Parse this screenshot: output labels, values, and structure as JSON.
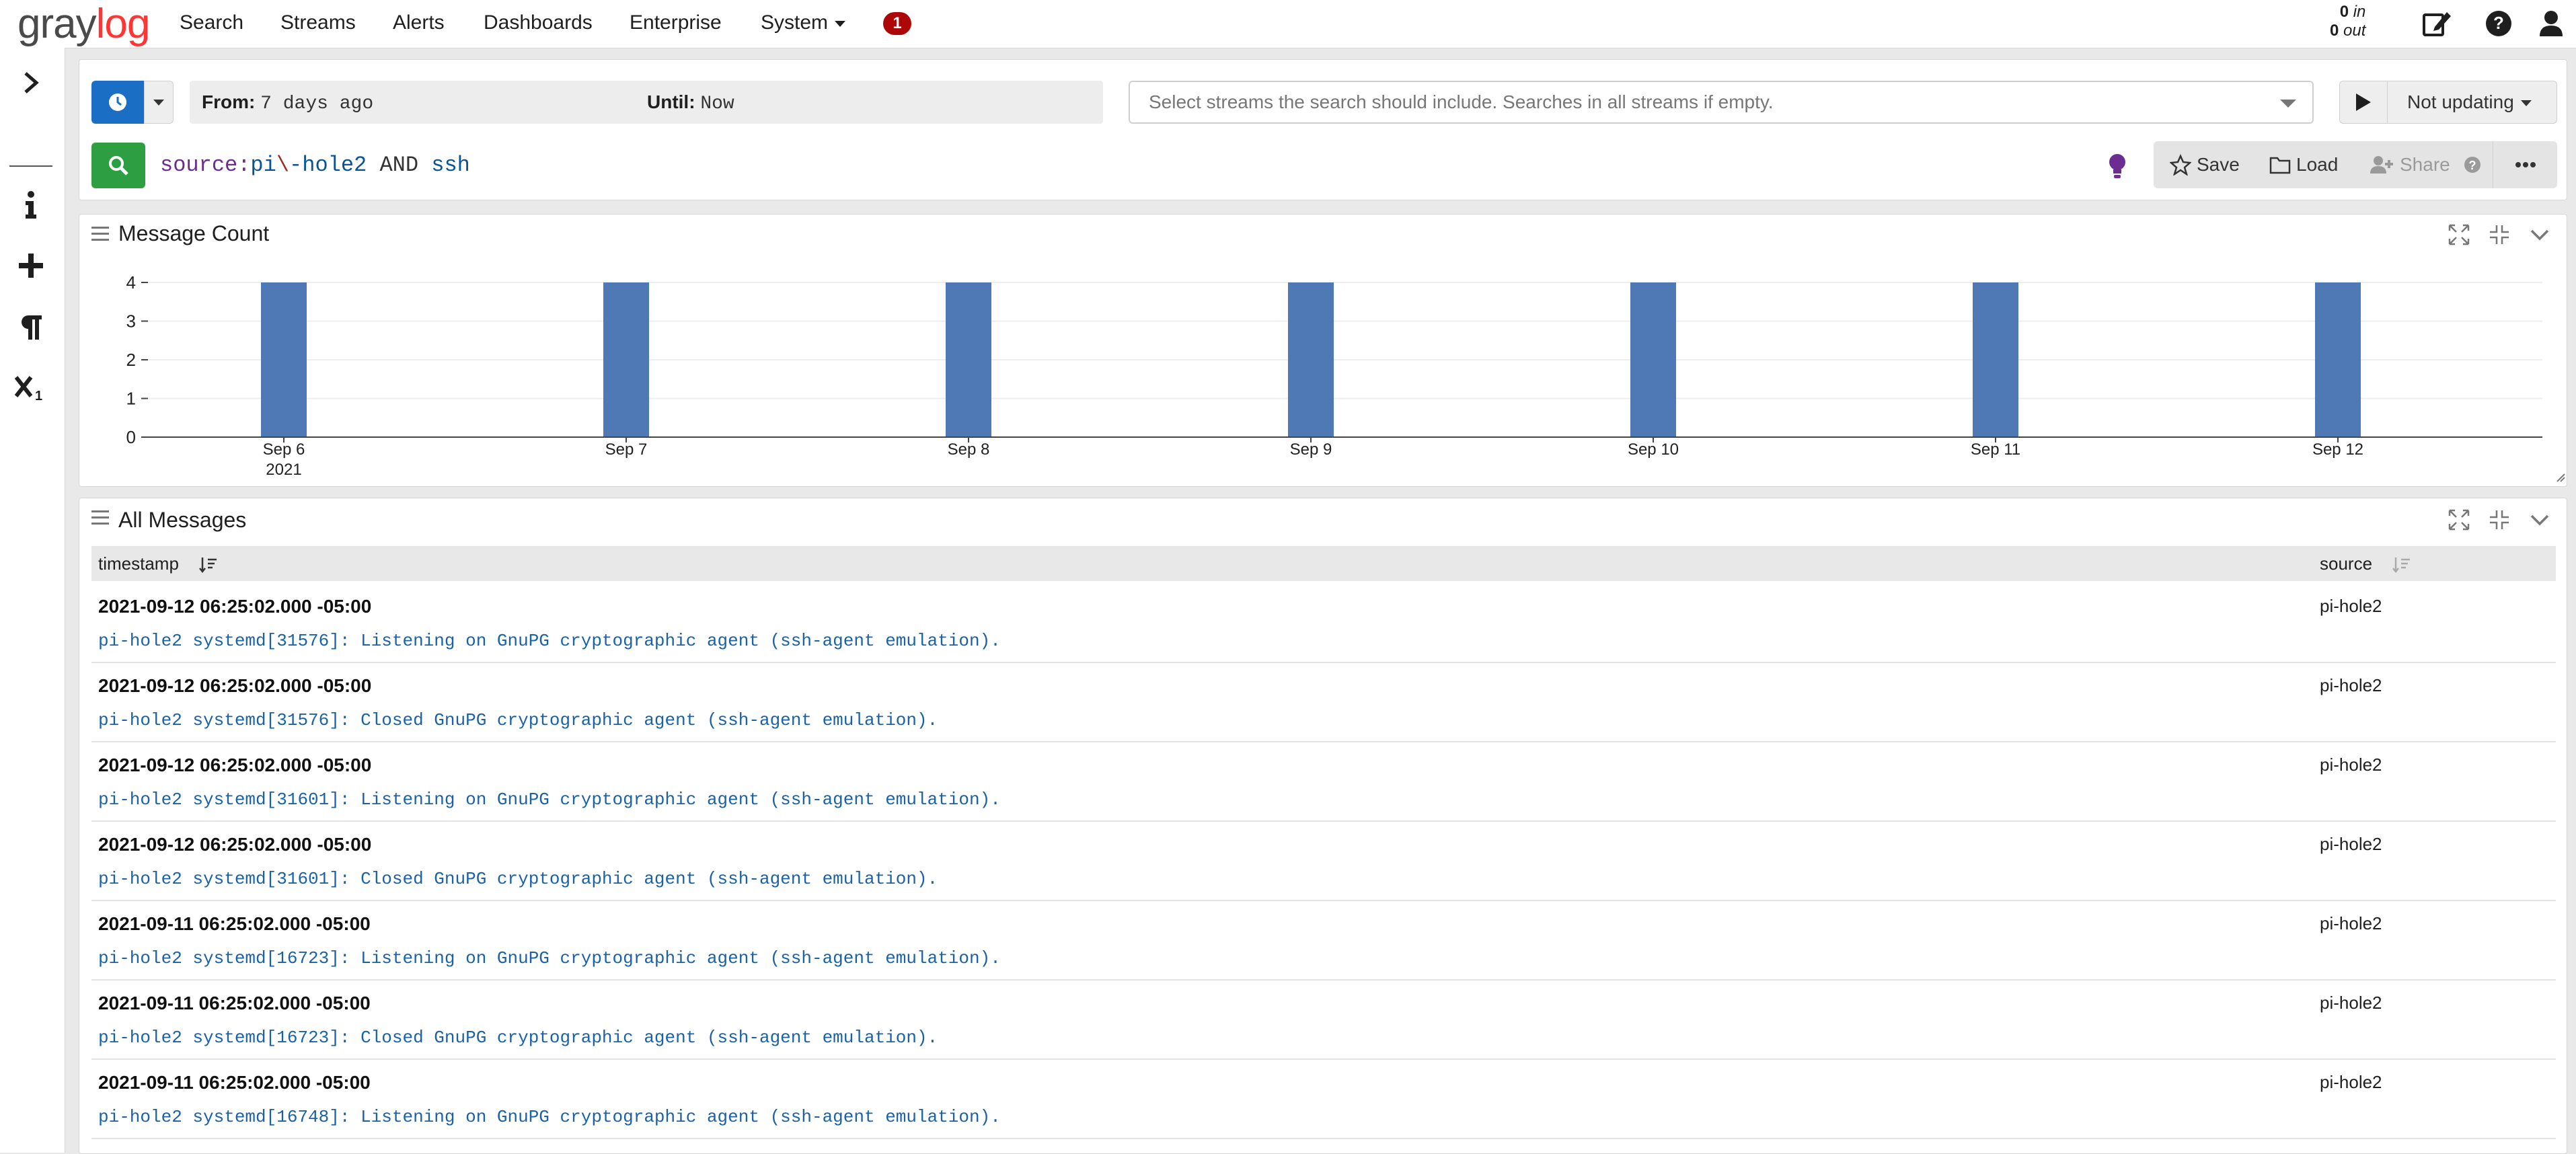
{
  "nav": {
    "logo_gray": "gray",
    "logo_red": "log",
    "links": [
      "Search",
      "Streams",
      "Alerts",
      "Dashboards",
      "Enterprise"
    ],
    "system_label": "System",
    "notification_count": "1",
    "throughput": {
      "in_count": "0",
      "in_label": "in",
      "out_count": "0",
      "out_label": "out"
    },
    "icons": [
      "edit-icon",
      "help-icon",
      "user-icon"
    ]
  },
  "sidebar": {
    "icons": [
      "expand-chevron-icon",
      "info-icon",
      "plus-icon",
      "paragraph-icon",
      "function-icon"
    ]
  },
  "search": {
    "from_label": "From:",
    "from_value": "7 days ago",
    "until_label": "Until:",
    "until_value": "Now",
    "streams_placeholder": "Select streams the search should include. Searches in all streams if empty.",
    "refresh_label": "Not updating",
    "query": {
      "field": "source:",
      "val1": "pi",
      "esc": "\\",
      "val2": "-hole2",
      "op": "AND",
      "term": "ssh"
    },
    "actions": {
      "save": "Save",
      "load": "Load",
      "share": "Share"
    }
  },
  "message_count_widget": {
    "title": "Message Count"
  },
  "chart_data": {
    "type": "bar",
    "categories": [
      "Sep 6",
      "Sep 7",
      "Sep 8",
      "Sep 9",
      "Sep 10",
      "Sep 11",
      "Sep 12"
    ],
    "year_label": "2021",
    "values": [
      4,
      4,
      4,
      4,
      4,
      4,
      4
    ],
    "ylim": [
      0,
      4
    ],
    "yticks": [
      0,
      1,
      2,
      3,
      4
    ],
    "grid": true,
    "color": "#4e79b4"
  },
  "messages_widget": {
    "title": "All Messages",
    "columns": {
      "timestamp": "timestamp",
      "source": "source"
    },
    "rows": [
      {
        "timestamp": "2021-09-12 06:25:02.000 -05:00",
        "source": "pi-hole2",
        "message": "pi-hole2 systemd[31576]: Listening on GnuPG cryptographic agent (ssh-agent emulation)."
      },
      {
        "timestamp": "2021-09-12 06:25:02.000 -05:00",
        "source": "pi-hole2",
        "message": "pi-hole2 systemd[31576]: Closed GnuPG cryptographic agent (ssh-agent emulation)."
      },
      {
        "timestamp": "2021-09-12 06:25:02.000 -05:00",
        "source": "pi-hole2",
        "message": "pi-hole2 systemd[31601]: Listening on GnuPG cryptographic agent (ssh-agent emulation)."
      },
      {
        "timestamp": "2021-09-12 06:25:02.000 -05:00",
        "source": "pi-hole2",
        "message": "pi-hole2 systemd[31601]: Closed GnuPG cryptographic agent (ssh-agent emulation)."
      },
      {
        "timestamp": "2021-09-11 06:25:02.000 -05:00",
        "source": "pi-hole2",
        "message": "pi-hole2 systemd[16723]: Listening on GnuPG cryptographic agent (ssh-agent emulation)."
      },
      {
        "timestamp": "2021-09-11 06:25:02.000 -05:00",
        "source": "pi-hole2",
        "message": "pi-hole2 systemd[16723]: Closed GnuPG cryptographic agent (ssh-agent emulation)."
      },
      {
        "timestamp": "2021-09-11 06:25:02.000 -05:00",
        "source": "pi-hole2",
        "message": "pi-hole2 systemd[16748]: Listening on GnuPG cryptographic agent (ssh-agent emulation)."
      }
    ]
  },
  "colors": {
    "primary_blue": "#1a6fc4",
    "search_green": "#2d9f42",
    "badge_red": "#ad0707",
    "logo_red": "#ff3633",
    "message_blue": "#1a62a8",
    "bar_blue": "#4e79b4"
  }
}
